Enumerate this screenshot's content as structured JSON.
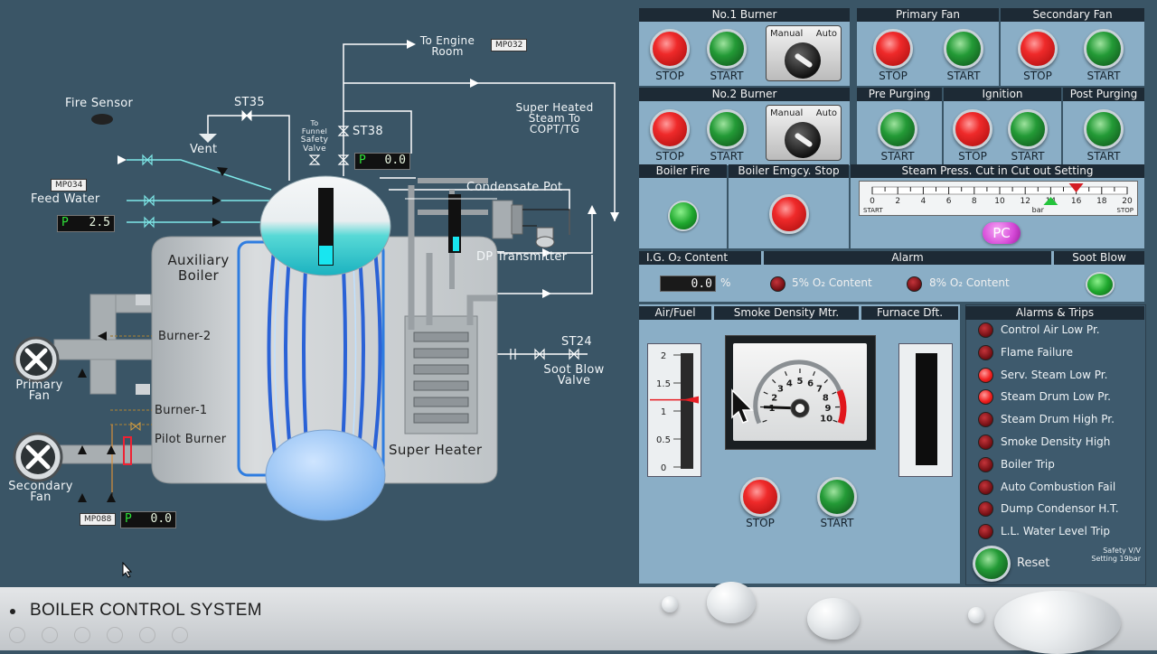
{
  "diagram": {
    "to_engine_room": "To Engine\nRoom",
    "tag_mp032": "MP032",
    "super_heated": "Super Heated\nSteam To\nCOPT/TG",
    "fire_sensor": "Fire Sensor",
    "st35": "ST35",
    "vent": "Vent",
    "to_funnel": "To\nFunnel",
    "safety_valve": "Safety\nValve",
    "st38": "ST38",
    "st38_p": "P",
    "st38_value": "0.0",
    "tag_mp034": "MP034",
    "feed_water": "Feed Water",
    "feed_p": "P",
    "feed_value": "2.5",
    "condensate_pot": "Condensate Pot",
    "dp_transmitter": "DP Transmitter",
    "auxiliary_boiler": "Auxiliary\nBoiler",
    "burner2": "Burner-2",
    "burner1": "Burner-1",
    "pilot_burner": "Pilot Burner",
    "primary_fan": "Primary\nFan",
    "secondary_fan": "Secondary\nFan",
    "tag_mp088": "MP088",
    "mp088_p": "P",
    "mp088_value": "0.0",
    "st24": "ST24",
    "soot_blow_valve": "Soot Blow\nValve",
    "super_heater": "Super Heater"
  },
  "panel": {
    "no1_burner": "No.1 Burner",
    "no2_burner": "No.2 Burner",
    "primary_fan": "Primary Fan",
    "secondary_fan": "Secondary Fan",
    "pre_purging": "Pre Purging",
    "ignition": "Ignition",
    "post_purging": "Post Purging",
    "stop": "STOP",
    "start": "START",
    "manual": "Manual",
    "auto": "Auto",
    "boiler_fire": "Boiler Fire",
    "boiler_emgcy_stop": "Boiler Emgcy. Stop",
    "steam_press": "Steam Press. Cut in Cut out Setting",
    "scale_labels": [
      "0",
      "2",
      "4",
      "6",
      "8",
      "10",
      "12",
      "14",
      "16",
      "18",
      "20"
    ],
    "scale_start": "START",
    "scale_stop": "STOP",
    "scale_unit": "bar",
    "cut_in": 14,
    "cut_out": 16,
    "pc": "PC",
    "ig_o2": "I.G. O₂  Content",
    "o2_value": "0.0",
    "o2_unit": "%",
    "alarm": "Alarm",
    "o2_5": "5% O₂ Content",
    "o2_8": "8% O₂ Content",
    "soot_blow": "Soot Blow",
    "air_fuel": "Air/Fuel",
    "smoke_density": "Smoke Density Mtr.",
    "furnace_dft": "Furnace Dft.",
    "af_scale": [
      "2",
      "1.5",
      "1",
      "0.5",
      "0"
    ],
    "af_value": 1.2,
    "gauge_labels": [
      "1",
      "2",
      "3",
      "4",
      "5",
      "6",
      "7",
      "8",
      "9",
      "10"
    ],
    "gauge_value": 1,
    "alarms_trips": "Alarms & Trips",
    "alarms": [
      {
        "label": "Control Air Low Pr.",
        "lit": false
      },
      {
        "label": "Flame Failure",
        "lit": false
      },
      {
        "label": "Serv. Steam Low Pr.",
        "lit": true
      },
      {
        "label": "Steam Drum Low Pr.",
        "lit": true
      },
      {
        "label": "Steam Drum High Pr.",
        "lit": false
      },
      {
        "label": "Smoke Density High",
        "lit": false
      },
      {
        "label": "Boiler Trip",
        "lit": false
      },
      {
        "label": "Auto Combustion Fail",
        "lit": false
      },
      {
        "label": "Dump Condensor H.T.",
        "lit": false
      },
      {
        "label": "L.L. Water Level Trip",
        "lit": false
      }
    ],
    "reset": "Reset",
    "safety_note": "Safety V/V\nSetting 19bar"
  },
  "footer": {
    "title": "BOILER CONTROL SYSTEM"
  },
  "colors": {
    "background": "#3a5566",
    "panel": "#8aaec6",
    "header": "#1d2a35"
  }
}
